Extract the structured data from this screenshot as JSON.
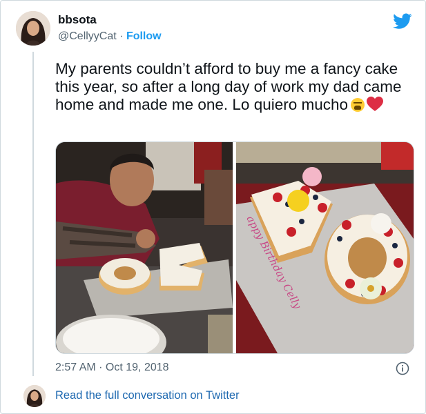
{
  "user": {
    "display_name": "bbsota",
    "handle": "@CellyyCat",
    "separator": "·",
    "follow_label": "Follow"
  },
  "tweet": {
    "text": "My parents couldn’t afford to buy me a fancy cake this year, so after a long day of work my dad came home and made me one. Lo quiero mucho",
    "emoji": [
      "weary-face",
      "red-heart"
    ],
    "timestamp": "2:57 AM · Oct 19, 2018"
  },
  "media": {
    "cake_lettering": "appy Birthday Celly"
  },
  "footer": {
    "read_more": "Read the full conversation on Twitter"
  },
  "colors": {
    "twitter_blue": "#1d9bf0",
    "link_blue": "#1d68b0",
    "secondary_text": "#536471",
    "border": "#cfd9de"
  }
}
